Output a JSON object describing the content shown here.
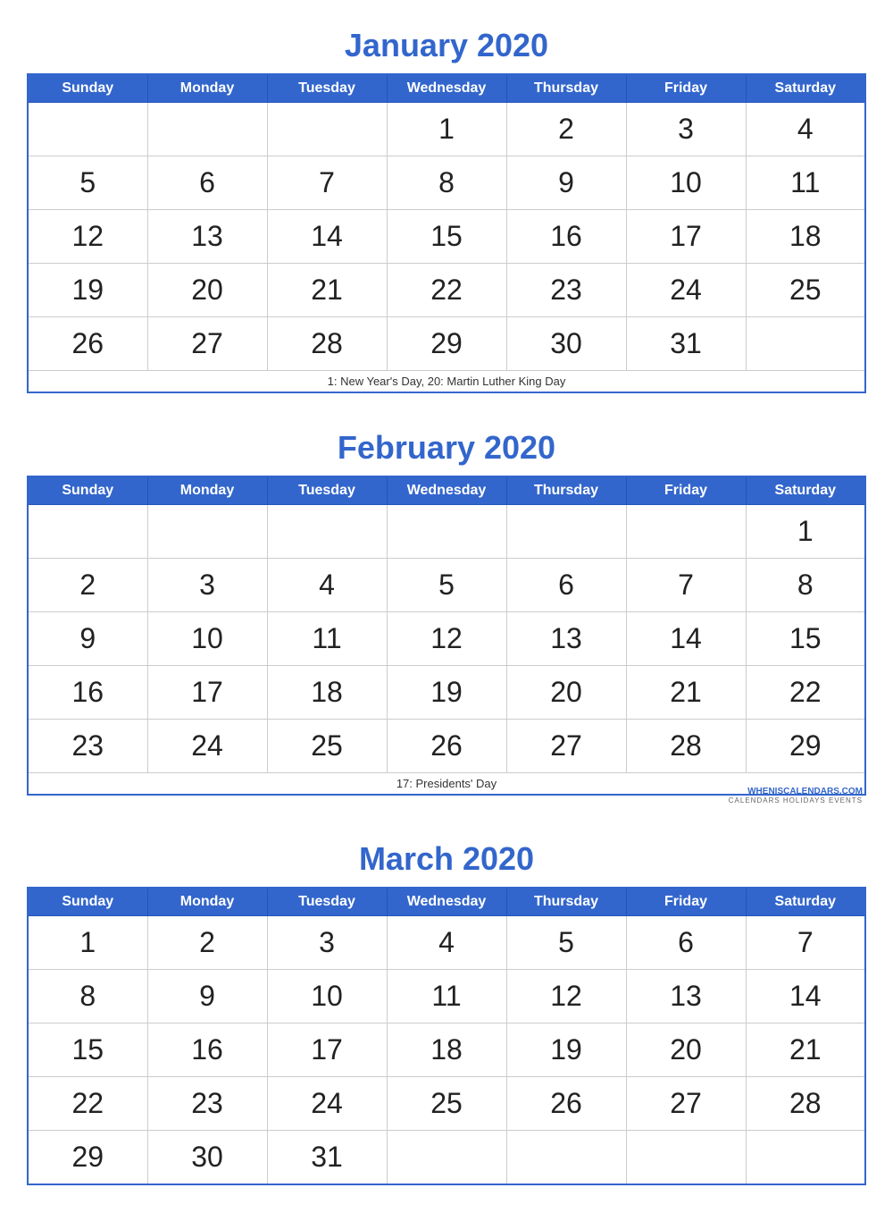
{
  "months": [
    {
      "id": "january",
      "title": "January 2020",
      "days": [
        "Sunday",
        "Monday",
        "Tuesday",
        "Wednesday",
        "Thursday",
        "Friday",
        "Saturday"
      ],
      "weeks": [
        [
          "",
          "",
          "",
          "1",
          "2",
          "3",
          "4"
        ],
        [
          "5",
          "6",
          "7",
          "8",
          "9",
          "10",
          "11"
        ],
        [
          "12",
          "13",
          "14",
          "15",
          "16",
          "17",
          "18"
        ],
        [
          "19",
          "20",
          "21",
          "22",
          "23",
          "24",
          "25"
        ],
        [
          "26",
          "27",
          "28",
          "29",
          "30",
          "31",
          ""
        ]
      ],
      "holiday": "1: New Year's Day, 20: Martin Luther King Day",
      "watermark": false
    },
    {
      "id": "february",
      "title": "February 2020",
      "days": [
        "Sunday",
        "Monday",
        "Tuesday",
        "Wednesday",
        "Thursday",
        "Friday",
        "Saturday"
      ],
      "weeks": [
        [
          "",
          "",
          "",
          "",
          "",
          "",
          "1"
        ],
        [
          "2",
          "3",
          "4",
          "5",
          "6",
          "7",
          "8"
        ],
        [
          "9",
          "10",
          "11",
          "12",
          "13",
          "14",
          "15"
        ],
        [
          "16",
          "17",
          "18",
          "19",
          "20",
          "21",
          "22"
        ],
        [
          "23",
          "24",
          "25",
          "26",
          "27",
          "28",
          "29"
        ]
      ],
      "holiday": "17: Presidents' Day",
      "watermark": true,
      "watermark_text": "WHENISCALENDARS.COM",
      "watermark_sub": "CALENDARS   HOLIDAYS   EVENTS"
    },
    {
      "id": "march",
      "title": "March 2020",
      "days": [
        "Sunday",
        "Monday",
        "Tuesday",
        "Wednesday",
        "Thursday",
        "Friday",
        "Saturday"
      ],
      "weeks": [
        [
          "1",
          "2",
          "3",
          "4",
          "5",
          "6",
          "7"
        ],
        [
          "8",
          "9",
          "10",
          "11",
          "12",
          "13",
          "14"
        ],
        [
          "15",
          "16",
          "17",
          "18",
          "19",
          "20",
          "21"
        ],
        [
          "22",
          "23",
          "24",
          "25",
          "26",
          "27",
          "28"
        ],
        [
          "29",
          "30",
          "31",
          "",
          "",
          "",
          ""
        ]
      ],
      "holiday": "",
      "watermark": false
    }
  ]
}
